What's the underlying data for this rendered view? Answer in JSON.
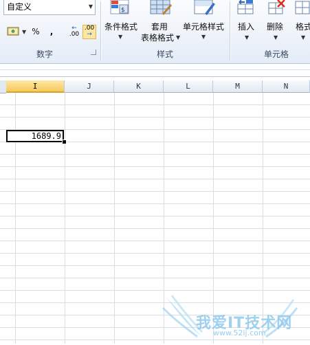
{
  "ribbon": {
    "number_format": {
      "value": "自定义"
    },
    "number_buttons": {
      "percent": "%",
      "comma": ",",
      "increase_decimal": ".00",
      "decrease_decimal": ".00"
    },
    "groups": [
      {
        "label": "数字"
      },
      {
        "label": "样式"
      },
      {
        "label": "单元格"
      }
    ],
    "styles": {
      "conditional": "条件格式",
      "table_line1": "套用",
      "table_line2": "表格格式",
      "cell_styles": "单元格样式"
    },
    "cells": {
      "insert": "插入",
      "delete": "删除",
      "format": "格式"
    }
  },
  "sheet": {
    "columns": [
      "I",
      "J",
      "K",
      "L",
      "M",
      "N"
    ],
    "active_column": "I",
    "active_cell_value": "1689.9"
  },
  "watermark": {
    "text": "我爱IT技术网",
    "url": "www.52ij.com"
  },
  "colors": {
    "accent": "#f7c95a",
    "ribbon": "#e4ecf7",
    "watermark": "#8ec9ec"
  }
}
